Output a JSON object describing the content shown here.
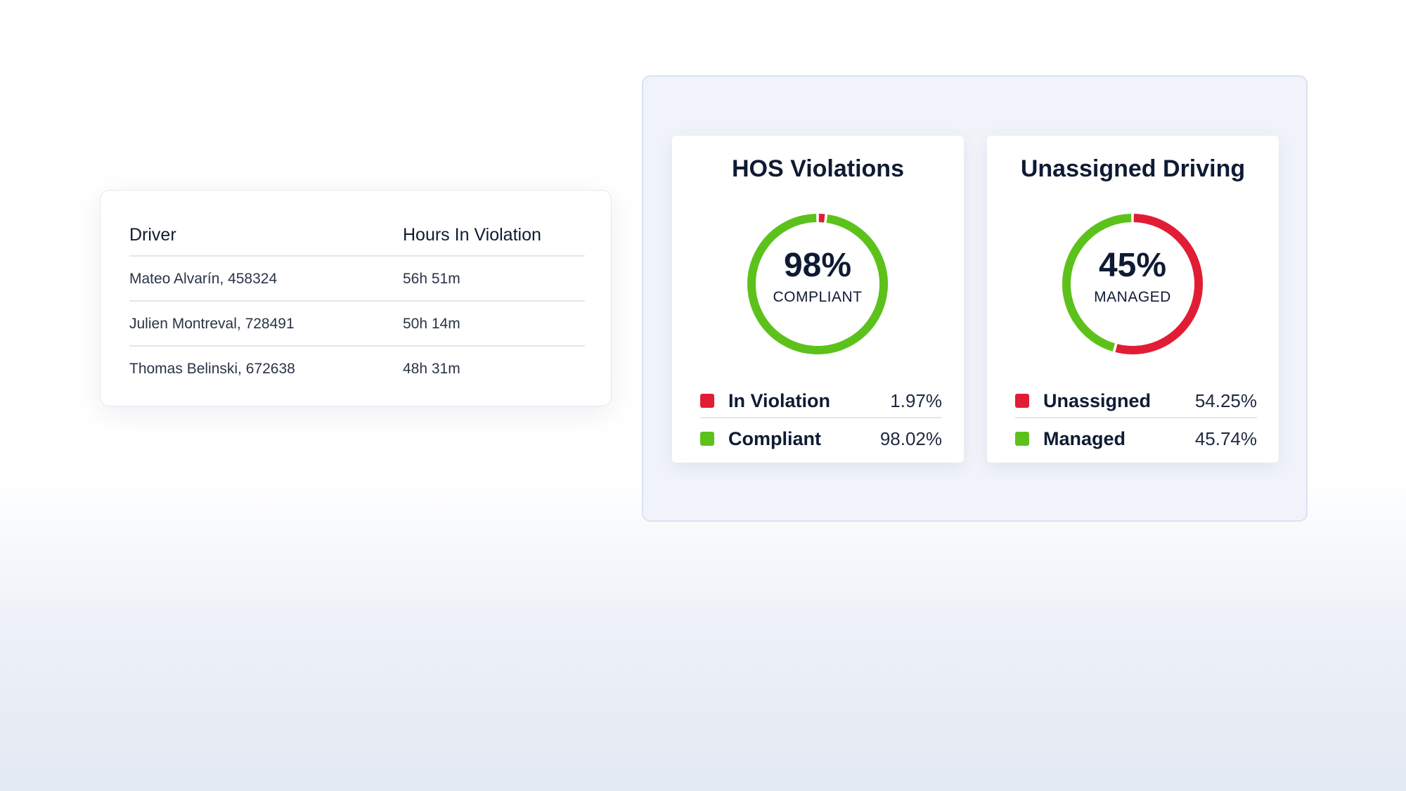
{
  "colors": {
    "violation_red": "#e11d35",
    "compliant_green": "#5cc21b",
    "text_dark": "#0f1b33"
  },
  "driver_table": {
    "columns": [
      "Driver",
      "Hours In Violation"
    ],
    "rows": [
      {
        "driver": "Mateo Alvarín, 458324",
        "hours": "56h 51m"
      },
      {
        "driver": "Julien Montreval, 728491",
        "hours": "50h 14m"
      },
      {
        "driver": "Thomas Belinski, 672638",
        "hours": "48h 31m"
      }
    ]
  },
  "hos_card": {
    "title": "HOS Violations",
    "center_value": "98%",
    "center_caption": "COMPLIANT",
    "legend": [
      {
        "label": "In Violation",
        "value": "1.97%",
        "color": "#e11d35"
      },
      {
        "label": "Compliant",
        "value": "98.02%",
        "color": "#5cc21b"
      }
    ]
  },
  "unassigned_card": {
    "title": "Unassigned Driving",
    "center_value": "45%",
    "center_caption": "MANAGED",
    "legend": [
      {
        "label": "Unassigned",
        "value": "54.25%",
        "color": "#e11d35"
      },
      {
        "label": "Managed",
        "value": "45.74%",
        "color": "#5cc21b"
      }
    ]
  },
  "chart_data": [
    {
      "type": "pie",
      "title": "HOS Violations",
      "categories": [
        "In Violation",
        "Compliant"
      ],
      "values": [
        1.97,
        98.02
      ],
      "colors": [
        "#e11d35",
        "#5cc21b"
      ]
    },
    {
      "type": "pie",
      "title": "Unassigned Driving",
      "categories": [
        "Unassigned",
        "Managed"
      ],
      "values": [
        54.25,
        45.74
      ],
      "colors": [
        "#e11d35",
        "#5cc21b"
      ]
    }
  ]
}
